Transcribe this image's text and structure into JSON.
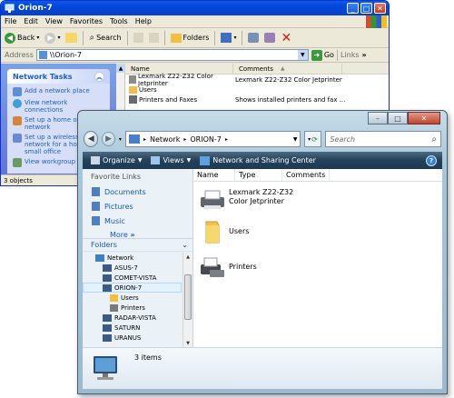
{
  "xp": {
    "title": "Orion-7",
    "menu": [
      "File",
      "Edit",
      "View",
      "Favorites",
      "Tools",
      "Help"
    ],
    "toolbar": {
      "back": "Back",
      "search": "Search",
      "folders": "Folders"
    },
    "address": {
      "label": "Address",
      "value": "\\\\Orion-7",
      "go": "Go",
      "links": "Links"
    },
    "tasks": {
      "title": "Network Tasks",
      "items": [
        "Add a network place",
        "View network connections",
        "Set up a home or office network",
        "Set up a wireless network for a home or small office",
        "View workgroup"
      ]
    },
    "columns": {
      "name": "Name",
      "comments": "Comments"
    },
    "rows": [
      {
        "name": "Lexmark Z22-Z32 Color Jetprinter",
        "comments": "Lexmark Z22-Z32 Color Jetprinter"
      },
      {
        "name": "Users",
        "comments": ""
      },
      {
        "name": "Printers and Faxes",
        "comments": "Shows installed printers and fax ..."
      }
    ],
    "status": "3 objects"
  },
  "vista": {
    "breadcrumb": [
      "Network",
      "ORION-7"
    ],
    "search_placeholder": "Search",
    "cmd": {
      "organize": "Organize",
      "views": "Views",
      "nsc": "Network and Sharing Center"
    },
    "favorites": {
      "title": "Favorite Links",
      "items": [
        "Documents",
        "Pictures",
        "Music"
      ],
      "more": "More"
    },
    "folders": {
      "title": "Folders"
    },
    "tree": [
      "Network",
      "ASUS-7",
      "COMET-VISTA",
      "ORION-7",
      "Users",
      "Printers",
      "RADAR-VISTA",
      "SATURN",
      "URANUS"
    ],
    "columns": {
      "name": "Name",
      "type": "Type",
      "comments": "Comments"
    },
    "items": [
      "Lexmark Z22-Z32 Color Jetprinter",
      "Users",
      "Printers"
    ],
    "count": "3 items"
  }
}
